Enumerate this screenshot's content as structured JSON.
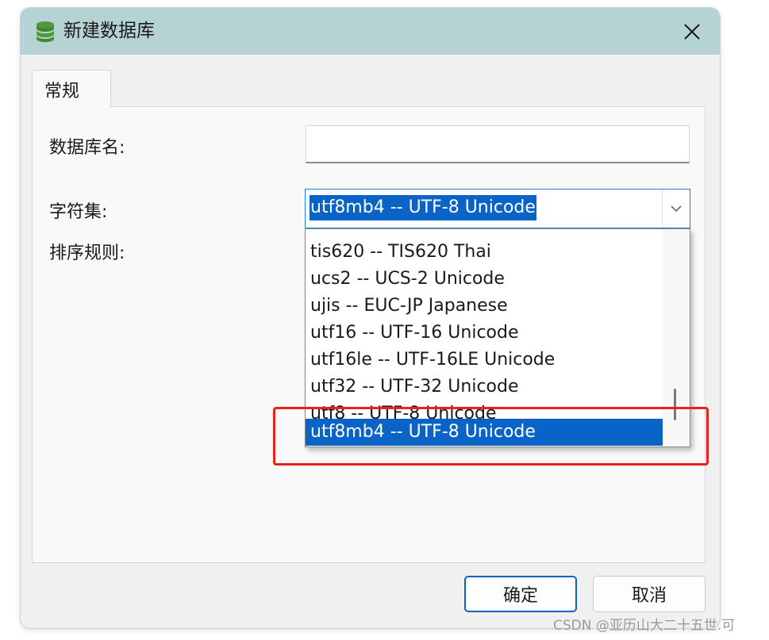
{
  "window": {
    "title": "新建数据库",
    "icon": "database-icon",
    "close_icon": "close-icon"
  },
  "tabs": [
    {
      "label": "常规",
      "active": true
    }
  ],
  "form": {
    "db_name_label": "数据库名:",
    "db_name_value": "",
    "charset_label": "字符集:",
    "charset_value": "utf8mb4 -- UTF-8 Unicode",
    "collation_label": "排序规则:"
  },
  "charset_dropdown": {
    "options": [
      "tis620 -- TIS620 Thai",
      "ucs2 -- UCS-2 Unicode",
      "ujis -- EUC-JP Japanese",
      "utf16 -- UTF-16 Unicode",
      "utf16le -- UTF-16LE Unicode",
      "utf32 -- UTF-32 Unicode",
      "utf8 -- UTF-8 Unicode",
      "utf8mb4 -- UTF-8 Unicode"
    ],
    "selected_index": 7
  },
  "buttons": {
    "ok": "确定",
    "cancel": "取消"
  },
  "watermark": "CSDN @亚历山大二十五世.可",
  "colors": {
    "titlebar": "#b6d3d3",
    "selection": "#0a64c8",
    "highlight_box": "#e8231c"
  }
}
